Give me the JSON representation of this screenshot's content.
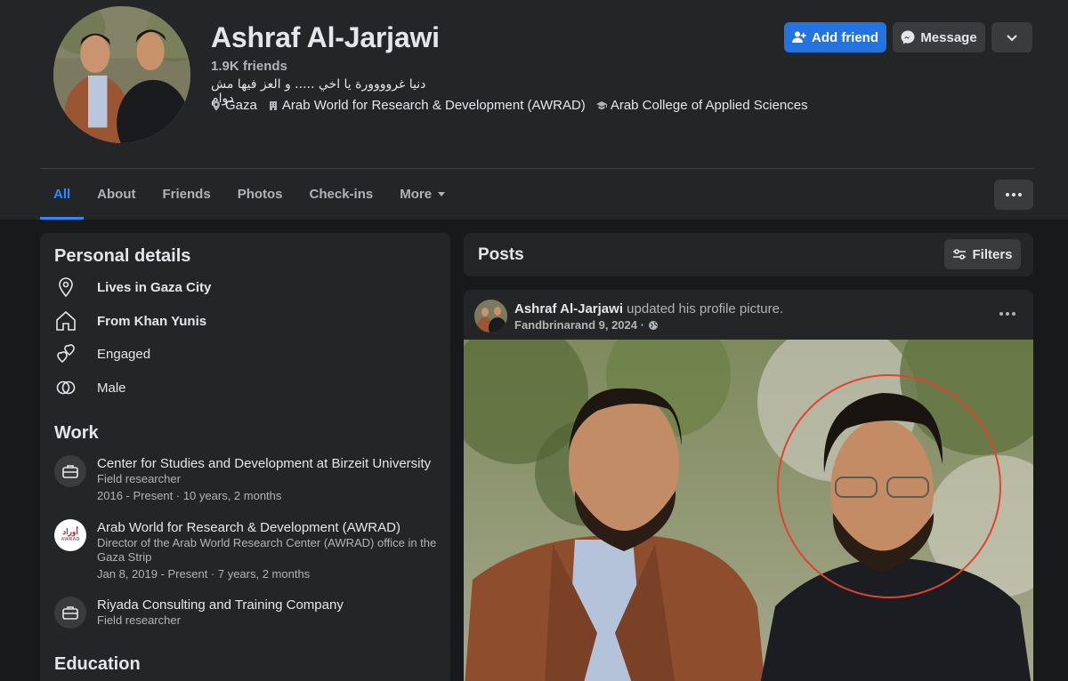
{
  "profile": {
    "name": "Ashraf Al-Jarjawi",
    "friends": "1.9K friends",
    "bio": "دنيا غروووورة يا اخي ..... و العز فيها مش دوام",
    "meta": {
      "location": "Gaza",
      "workplace": "Arab World for Research & Development (AWRAD)",
      "school": "Arab College of Applied Sciences"
    }
  },
  "actions": {
    "add_friend": "Add friend",
    "message": "Message"
  },
  "tabs": {
    "all": "All",
    "about": "About",
    "friends": "Friends",
    "photos": "Photos",
    "checkins": "Check-ins",
    "more": "More"
  },
  "personal_details": {
    "title": "Personal details",
    "lives": "Lives in Gaza City",
    "from": "From Khan Yunis",
    "relationship": "Engaged",
    "gender": "Male"
  },
  "work": {
    "title": "Work",
    "items": [
      {
        "company": "Center for Studies and Development at Birzeit University",
        "role": "Field researcher",
        "dates": "2016 - Present · 10 years, 2 months"
      },
      {
        "company": "Arab World for Research & Development (AWRAD)",
        "role": "Director of the Arab World Research Center (AWRAD) office in the Gaza Strip",
        "dates": "Jan 8, 2019 - Present · 7 years, 2 months",
        "logo_text": "أوراد",
        "logo_sub": "AWRAD"
      },
      {
        "company": "Riyada Consulting and Training Company",
        "role": "Field researcher"
      }
    ]
  },
  "education": {
    "title": "Education"
  },
  "posts": {
    "title": "Posts",
    "filters": "Filters",
    "post": {
      "author": "Ashraf Al-Jarjawi",
      "action": " updated his profile picture.",
      "date": "Fandbrinarand 9, 2024 ·"
    }
  },
  "icons": [
    "add-person-icon",
    "messenger-icon",
    "chevron-down-icon",
    "location-pin-icon",
    "building-icon",
    "graduation-cap-icon",
    "home-icon",
    "hearts-icon",
    "gender-icon",
    "briefcase-icon",
    "sliders-icon",
    "globe-icon",
    "more-dots-icon"
  ],
  "colors": {
    "accent": "#2374e1",
    "tab_active": "#2d88ff",
    "background": "#18191a",
    "card": "#242526",
    "highlight_circle": "#e0432e"
  }
}
